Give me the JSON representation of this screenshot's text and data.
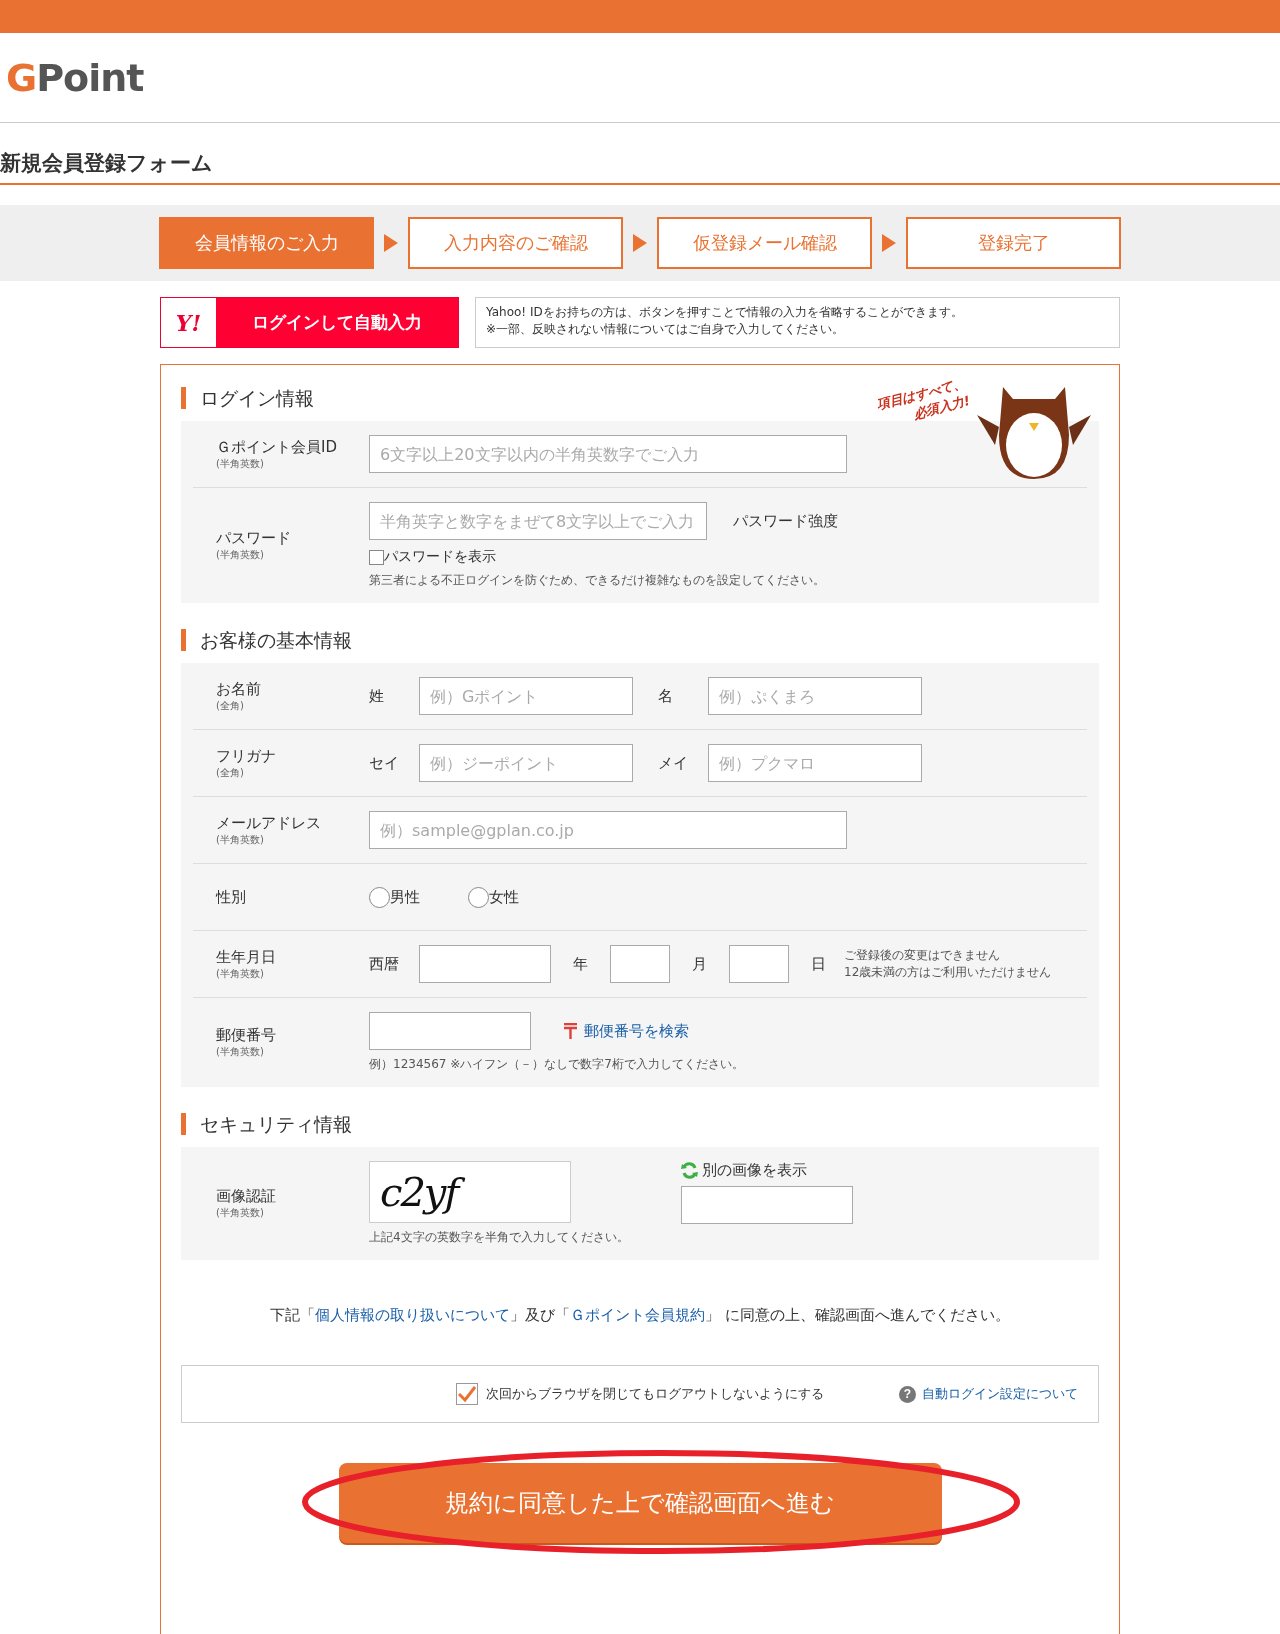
{
  "logo": {
    "mark": "G",
    "word": "Point"
  },
  "page_title": "新規会員登録フォーム",
  "steps": [
    {
      "label": "会員情報のご入力",
      "selected": true
    },
    {
      "label": "入力内容のご確認",
      "selected": false
    },
    {
      "label": "仮登録メール確認",
      "selected": false
    },
    {
      "label": "登録完了",
      "selected": false
    }
  ],
  "yahoo": {
    "logo": "Y!",
    "button": "ログインして自動入力",
    "note": [
      "Yahoo! IDをお持ちの方は、ボタンを押すことで情報の入力を省略することができます。",
      "※一部、反映されない情報についてはご自身で入力してください。"
    ]
  },
  "sections": [
    {
      "title": "ログイン情報",
      "mascot": {
        "caption": [
          "項目はすべて、",
          "必須入力!"
        ]
      },
      "rows": [
        {
          "kind": "text",
          "label": "Ｇポイント会員ID",
          "sub": "(半角英数)",
          "placeholder": "6文字以上20文字以内の半角英数字でご入力"
        },
        {
          "kind": "password",
          "label": "パスワード",
          "sub": "(半角英数)",
          "placeholder": "半角英字と数字をまぜて8文字以上でご入力",
          "strength": "パスワード強度",
          "toggle": {
            "label": "パスワードを表示",
            "checked": false
          },
          "note": "第三者による不正ログインを防ぐため、できるだけ複雑なものを設定してください。"
        }
      ]
    },
    {
      "title": "お客様の基本情報",
      "rows": [
        {
          "kind": "pair",
          "label": "お名前",
          "sub": "(全角)",
          "fields": [
            {
              "caption": "姓",
              "placeholder": "例）Gポイント"
            },
            {
              "caption": "名",
              "placeholder": "例）ぷくまろ"
            }
          ]
        },
        {
          "kind": "pair",
          "label": "フリガナ",
          "sub": "(全角)",
          "fields": [
            {
              "caption": "セイ",
              "placeholder": "例）ジーポイント"
            },
            {
              "caption": "メイ",
              "placeholder": "例）プクマロ"
            }
          ]
        },
        {
          "kind": "text",
          "label": "メールアドレス",
          "sub": "(半角英数)",
          "placeholder": "例）sample@gplan.co.jp"
        },
        {
          "kind": "radio",
          "label": "性別",
          "options": [
            {
              "label": "男性",
              "selected": false
            },
            {
              "label": "女性",
              "selected": false
            }
          ]
        },
        {
          "kind": "date",
          "label": "生年月日",
          "sub": "(半角英数)",
          "prefix": "西暦",
          "units": [
            "年",
            "月",
            "日"
          ],
          "notes": [
            "ご登録後の変更はできません",
            "12歳未満の方はご利用いただけません"
          ]
        },
        {
          "kind": "zip",
          "label": "郵便番号",
          "sub": "(半角英数)",
          "link": "郵便番号を検索",
          "note": "例）1234567 ※ハイフン（－）なしで数字7桁で入力してください。"
        }
      ]
    },
    {
      "title": "セキュリティ情報",
      "rows": [
        {
          "kind": "captcha",
          "label": "画像認証",
          "sub": "(半角英数)",
          "captcha": "c2yf",
          "refresh": "別の画像を表示",
          "note": "上記4文字の英数字を半角で入力してください。"
        }
      ]
    }
  ],
  "agreement": [
    {
      "kind": "text",
      "text": "下記「"
    },
    {
      "kind": "link",
      "text": "個人情報の取り扱いについて"
    },
    {
      "kind": "text",
      "text": "」及び「"
    },
    {
      "kind": "link",
      "text": "Ｇポイント会員規約"
    },
    {
      "kind": "text",
      "text": "」 に同意の上、確認画面へ進んでください。"
    }
  ],
  "remember": {
    "label": "次回からブラウザを閉じてもログアウトしないようにする",
    "checked": true,
    "help_icon": "?",
    "help": "自動ログイン設定について"
  },
  "submit": "規約に同意した上で確認画面へ進む"
}
